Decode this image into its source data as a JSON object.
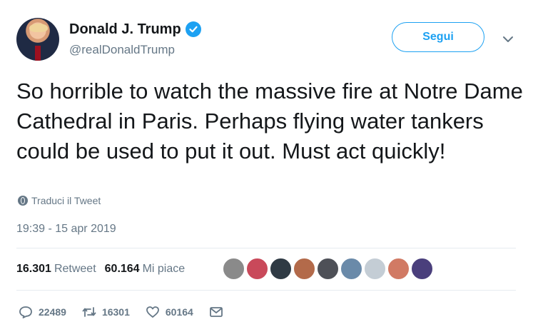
{
  "author": {
    "display_name": "Donald J. Trump",
    "handle": "@realDonaldTrump",
    "verified": true
  },
  "follow_button": {
    "label": "Segui"
  },
  "tweet": {
    "text": "So horrible to watch the massive fire at Notre Dame Cathedral in Paris. Perhaps flying water tankers could be used to put it out. Must act quickly!",
    "translate_label": "Traduci il Tweet",
    "timestamp": "19:39 - 15 apr 2019"
  },
  "stats": {
    "retweets_count": "16.301",
    "retweets_label": "Retweet",
    "likes_count": "60.164",
    "likes_label": "Mi piace"
  },
  "actions": {
    "replies": "22489",
    "retweets": "16301",
    "likes": "60164"
  },
  "colors": {
    "accent": "#1da1f2",
    "secondary_text": "#657786",
    "primary_text": "#14171a",
    "divider": "#e6ecf0"
  },
  "liker_avatars": [
    {
      "name": "liker-avatar-1",
      "color": "#8a8a8a"
    },
    {
      "name": "liker-avatar-2",
      "color": "#c9495a"
    },
    {
      "name": "liker-avatar-3",
      "color": "#2f3a44"
    },
    {
      "name": "liker-avatar-4",
      "color": "#b36a4a"
    },
    {
      "name": "liker-avatar-5",
      "color": "#4e5057"
    },
    {
      "name": "liker-avatar-6",
      "color": "#6a8aa9"
    },
    {
      "name": "liker-avatar-7",
      "color": "#c4cdd5"
    },
    {
      "name": "liker-avatar-8",
      "color": "#d17a64"
    },
    {
      "name": "liker-avatar-9",
      "color": "#4a3f7c"
    }
  ]
}
